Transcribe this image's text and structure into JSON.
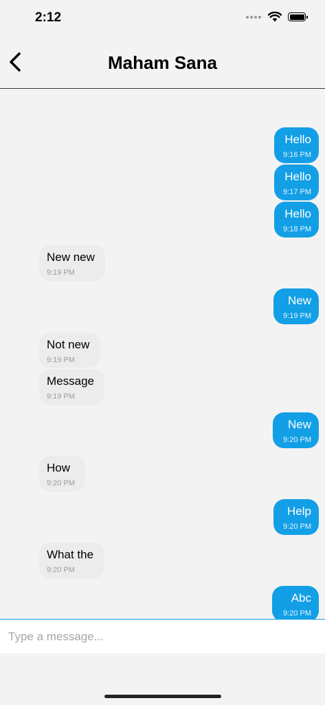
{
  "status_bar": {
    "time": "2:12"
  },
  "header": {
    "title": "Maham Sana"
  },
  "messages": [
    {
      "dir": "out",
      "text": "Hello",
      "time": "9:16 PM"
    },
    {
      "dir": "out",
      "text": "Hello",
      "time": "9:17 PM"
    },
    {
      "dir": "out",
      "text": "Hello",
      "time": "9:18 PM"
    },
    {
      "dir": "in",
      "text": "New new",
      "time": "9:19 PM"
    },
    {
      "dir": "out",
      "text": "New",
      "time": "9:19 PM"
    },
    {
      "dir": "in",
      "text": "Not new",
      "time": "9:19 PM"
    },
    {
      "dir": "in",
      "text": "Message",
      "time": "9:19 PM"
    },
    {
      "dir": "out",
      "text": "New",
      "time": "9:20 PM"
    },
    {
      "dir": "in",
      "text": "How",
      "time": "9:20 PM"
    },
    {
      "dir": "out",
      "text": "Help",
      "time": "9:20 PM"
    },
    {
      "dir": "in",
      "text": "What the",
      "time": "9:20 PM"
    },
    {
      "dir": "out",
      "text": "Abc",
      "time": "9:20 PM"
    }
  ],
  "composer": {
    "placeholder": "Type a message..."
  },
  "colors": {
    "outgoing_bubble": "#139fe6",
    "incoming_bubble": "#ececec",
    "background": "#f3f3f3"
  }
}
